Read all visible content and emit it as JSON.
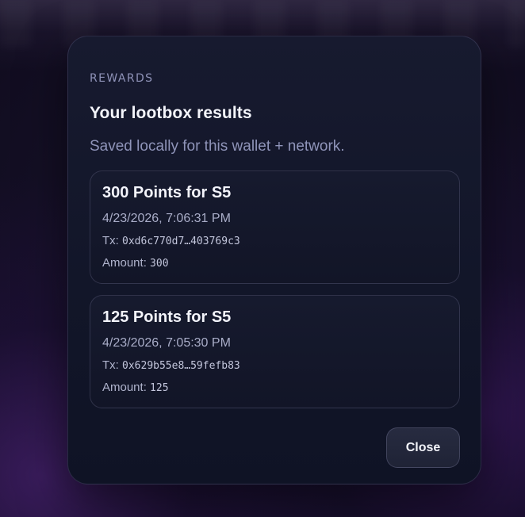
{
  "modal": {
    "eyebrow": "REWARDS",
    "title": "Your lootbox results",
    "subtitle": "Saved locally for this wallet + network.",
    "close_label": "Close"
  },
  "results": [
    {
      "title": "300 Points for S5",
      "date": "4/23/2026, 7:06:31 PM",
      "tx_label": "Tx:",
      "tx_value": "0xd6c770d7…403769c3",
      "amount_label": "Amount:",
      "amount_value": "300"
    },
    {
      "title": "125 Points for S5",
      "date": "4/23/2026, 7:05:30 PM",
      "tx_label": "Tx:",
      "tx_value": "0x629b55e8…59fefb83",
      "amount_label": "Amount:",
      "amount_value": "125"
    }
  ]
}
